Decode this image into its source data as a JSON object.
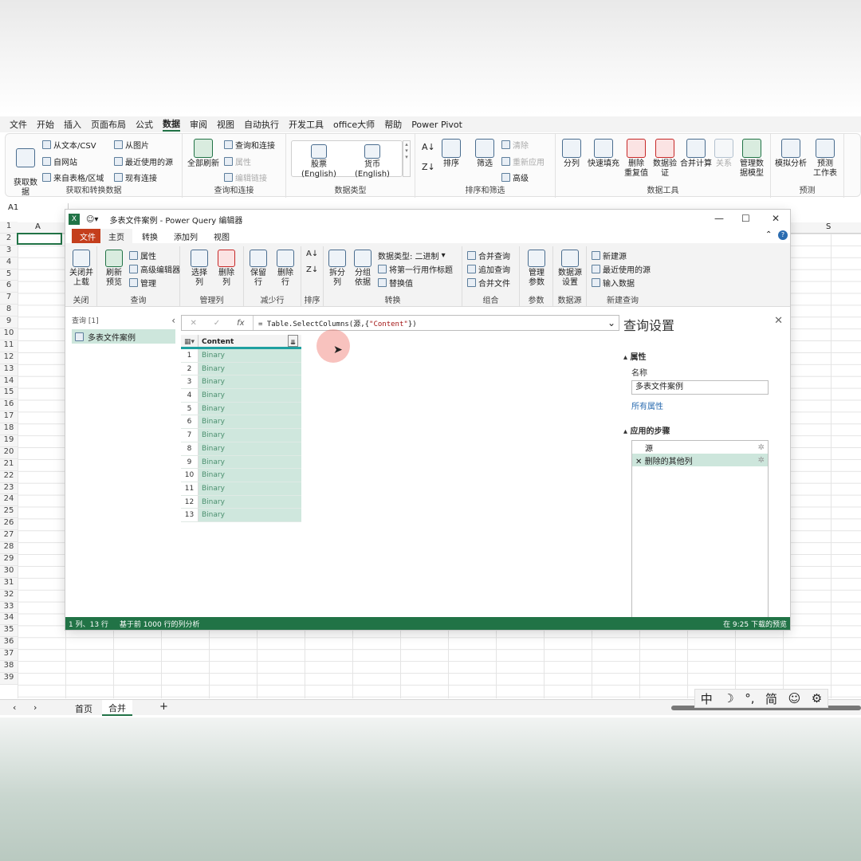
{
  "excel": {
    "menu": [
      "文件",
      "开始",
      "插入",
      "页面布局",
      "公式",
      "数据",
      "审阅",
      "视图",
      "自动执行",
      "开发工具",
      "office大师",
      "帮助",
      "Power Pivot"
    ],
    "active_menu": "数据",
    "ribbon": {
      "get_data": {
        "big": "获取数\n据",
        "items": [
          "从文本/CSV",
          "自网站",
          "来自表格/区域",
          "从图片",
          "最近使用的源",
          "现有连接"
        ],
        "label": "获取和转换数据"
      },
      "queries": {
        "big": "全部刷新",
        "items": [
          "查询和连接",
          "属性",
          "编辑链接"
        ],
        "label": "查询和连接"
      },
      "datatypes": {
        "items": [
          "股票 (English)",
          "货币 (English)"
        ],
        "label": "数据类型"
      },
      "sort": {
        "sort": "排序",
        "filter": "筛选",
        "items": [
          "清除",
          "重新应用",
          "高级"
        ],
        "label": "排序和筛选"
      },
      "tools": {
        "items": [
          "分列",
          "快速填充",
          "删除\n重复值",
          "数据验\n证",
          "合并计算",
          "关系",
          "管理数\n据模型"
        ],
        "label": "数据工具"
      },
      "forecast": {
        "items": [
          "模拟分析",
          "预测\n工作表"
        ],
        "label": "预测"
      }
    },
    "namebox": "A1",
    "col_headers": [
      "A",
      "S"
    ],
    "rows": [
      "1",
      "2",
      "3",
      "4",
      "5",
      "6",
      "7",
      "8",
      "9",
      "10",
      "11",
      "12",
      "13",
      "14",
      "15",
      "16",
      "17",
      "18",
      "19",
      "20",
      "21",
      "22",
      "23",
      "24",
      "25",
      "26",
      "27",
      "28",
      "29",
      "30",
      "31",
      "32",
      "33",
      "34",
      "35",
      "36",
      "37",
      "38",
      "39"
    ],
    "sheets": [
      "首页",
      "合并"
    ],
    "active_sheet": "合并"
  },
  "pq": {
    "title": "多表文件案例 - Power Query 编辑器",
    "tabs": [
      "文件",
      "主页",
      "转换",
      "添加列",
      "视图"
    ],
    "ribbon": {
      "close": {
        "btn": "关闭并\n上载",
        "label": "关闭"
      },
      "query": {
        "btn": "刷新\n预览",
        "items": [
          "属性",
          "高级编辑器",
          "管理"
        ],
        "label": "查询"
      },
      "cols": {
        "btns": [
          "选择\n列",
          "删除\n列"
        ],
        "label": "管理列"
      },
      "rows": {
        "btns": [
          "保留\n行",
          "删除\n行"
        ],
        "label": "减少行"
      },
      "sort": {
        "label": "排序"
      },
      "transform": {
        "btns": [
          "拆分\n列",
          "分组\n依据"
        ],
        "items": [
          "数据类型: 二进制",
          "将第一行用作标题",
          "替换值"
        ],
        "label": "转换"
      },
      "combine": {
        "items": [
          "合并查询",
          "追加查询",
          "合并文件"
        ],
        "label": "组合"
      },
      "params": {
        "btn": "管理\n参数",
        "label": "参数"
      },
      "datasource": {
        "btn": "数据源\n设置",
        "label": "数据源"
      },
      "newquery": {
        "items": [
          "新建源",
          "最近使用的源",
          "输入数据"
        ],
        "label": "新建查询"
      }
    },
    "queries_pane": {
      "header": "查询 [1]",
      "item": "多表文件案例"
    },
    "formula": {
      "prefix": "= Table.SelectColumns(源,{",
      "str": "\"Content\"",
      "suffix": "})"
    },
    "column": "Content",
    "rows": [
      {
        "n": "1",
        "v": "Binary"
      },
      {
        "n": "2",
        "v": "Binary"
      },
      {
        "n": "3",
        "v": "Binary"
      },
      {
        "n": "4",
        "v": "Binary"
      },
      {
        "n": "5",
        "v": "Binary"
      },
      {
        "n": "6",
        "v": "Binary"
      },
      {
        "n": "7",
        "v": "Binary"
      },
      {
        "n": "8",
        "v": "Binary"
      },
      {
        "n": "9",
        "v": "Binary"
      },
      {
        "n": "10",
        "v": "Binary"
      },
      {
        "n": "11",
        "v": "Binary"
      },
      {
        "n": "12",
        "v": "Binary"
      },
      {
        "n": "13",
        "v": "Binary"
      }
    ],
    "settings": {
      "title": "查询设置",
      "properties": "属性",
      "name_label": "名称",
      "name_value": "多表文件案例",
      "all_props": "所有属性",
      "steps_title": "应用的步骤",
      "steps": [
        "源",
        "删除的其他列"
      ]
    },
    "status": {
      "left1": "1 列、13 行",
      "left2": "基于前 1000 行的列分析",
      "right": "在 9:25 下载的预览"
    }
  },
  "ime": [
    "中",
    "☽",
    "°,",
    "简",
    "☺",
    "⚙"
  ],
  "colors": {
    "excel_green": "#217346",
    "pq_file": "#c43e1c",
    "cell_fill": "#cfe7dd"
  }
}
